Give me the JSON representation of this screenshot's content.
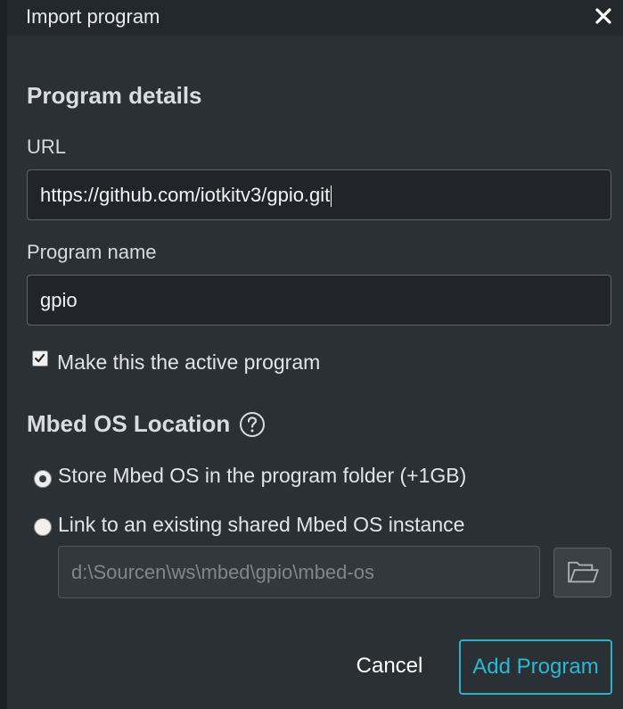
{
  "dialog": {
    "title": "Import program",
    "close_icon": "close-icon"
  },
  "program_details": {
    "heading": "Program details",
    "url_label": "URL",
    "url_value": "https://github.com/iotkitv3/gpio.git",
    "name_label": "Program name",
    "name_value": "gpio",
    "active_checkbox_label": "Make this the active program",
    "active_checked": true
  },
  "mbed_os_location": {
    "heading": "Mbed OS Location",
    "help_icon": "help-circle-icon",
    "options": [
      {
        "label": "Store Mbed OS in the program folder (+1GB)",
        "selected": true
      },
      {
        "label": "Link to an existing shared Mbed OS instance",
        "selected": false
      }
    ],
    "shared_path_placeholder": "d:\\Sourcen\\ws\\mbed\\gpio\\mbed-os",
    "browse_icon": "folder-open-icon"
  },
  "actions": {
    "cancel_label": "Cancel",
    "add_label": "Add Program"
  },
  "colors": {
    "background": "#2b3035",
    "titlebar": "#23282c",
    "accent": "#29b2cc"
  }
}
